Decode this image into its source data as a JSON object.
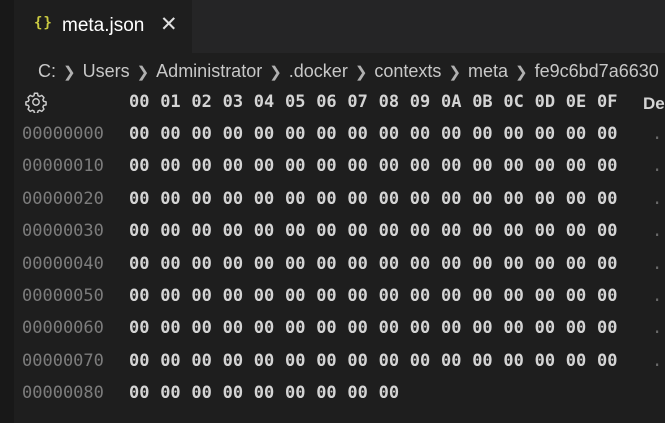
{
  "tab": {
    "icon": "{}",
    "label": "meta.json",
    "close": "✕"
  },
  "breadcrumb": [
    "C:",
    "Users",
    "Administrator",
    ".docker",
    "contexts",
    "meta",
    "fe9c6bd7a6630"
  ],
  "hex_view": {
    "settings_icon": "gear-icon",
    "column_headers": [
      "00",
      "01",
      "02",
      "03",
      "04",
      "05",
      "06",
      "07",
      "08",
      "09",
      "0A",
      "0B",
      "0C",
      "0D",
      "0E",
      "0F"
    ],
    "decoded_header": "De",
    "rows": [
      {
        "offset": "00000000",
        "bytes": [
          "00",
          "00",
          "00",
          "00",
          "00",
          "00",
          "00",
          "00",
          "00",
          "00",
          "00",
          "00",
          "00",
          "00",
          "00",
          "00"
        ],
        "decoded": "."
      },
      {
        "offset": "00000010",
        "bytes": [
          "00",
          "00",
          "00",
          "00",
          "00",
          "00",
          "00",
          "00",
          "00",
          "00",
          "00",
          "00",
          "00",
          "00",
          "00",
          "00"
        ],
        "decoded": "."
      },
      {
        "offset": "00000020",
        "bytes": [
          "00",
          "00",
          "00",
          "00",
          "00",
          "00",
          "00",
          "00",
          "00",
          "00",
          "00",
          "00",
          "00",
          "00",
          "00",
          "00"
        ],
        "decoded": "."
      },
      {
        "offset": "00000030",
        "bytes": [
          "00",
          "00",
          "00",
          "00",
          "00",
          "00",
          "00",
          "00",
          "00",
          "00",
          "00",
          "00",
          "00",
          "00",
          "00",
          "00"
        ],
        "decoded": "."
      },
      {
        "offset": "00000040",
        "bytes": [
          "00",
          "00",
          "00",
          "00",
          "00",
          "00",
          "00",
          "00",
          "00",
          "00",
          "00",
          "00",
          "00",
          "00",
          "00",
          "00"
        ],
        "decoded": "."
      },
      {
        "offset": "00000050",
        "bytes": [
          "00",
          "00",
          "00",
          "00",
          "00",
          "00",
          "00",
          "00",
          "00",
          "00",
          "00",
          "00",
          "00",
          "00",
          "00",
          "00"
        ],
        "decoded": "."
      },
      {
        "offset": "00000060",
        "bytes": [
          "00",
          "00",
          "00",
          "00",
          "00",
          "00",
          "00",
          "00",
          "00",
          "00",
          "00",
          "00",
          "00",
          "00",
          "00",
          "00"
        ],
        "decoded": "."
      },
      {
        "offset": "00000070",
        "bytes": [
          "00",
          "00",
          "00",
          "00",
          "00",
          "00",
          "00",
          "00",
          "00",
          "00",
          "00",
          "00",
          "00",
          "00",
          "00",
          "00"
        ],
        "decoded": "."
      },
      {
        "offset": "00000080",
        "bytes": [
          "00",
          "00",
          "00",
          "00",
          "00",
          "00",
          "00",
          "00",
          "00"
        ],
        "decoded": ""
      }
    ]
  },
  "colors": {
    "background": "#1e1e1e",
    "tab_inactive_bg": "#252526",
    "json_icon": "#cbcb41",
    "offset_text": "#7c7c7c",
    "byte_text": "#d4d4d4"
  }
}
